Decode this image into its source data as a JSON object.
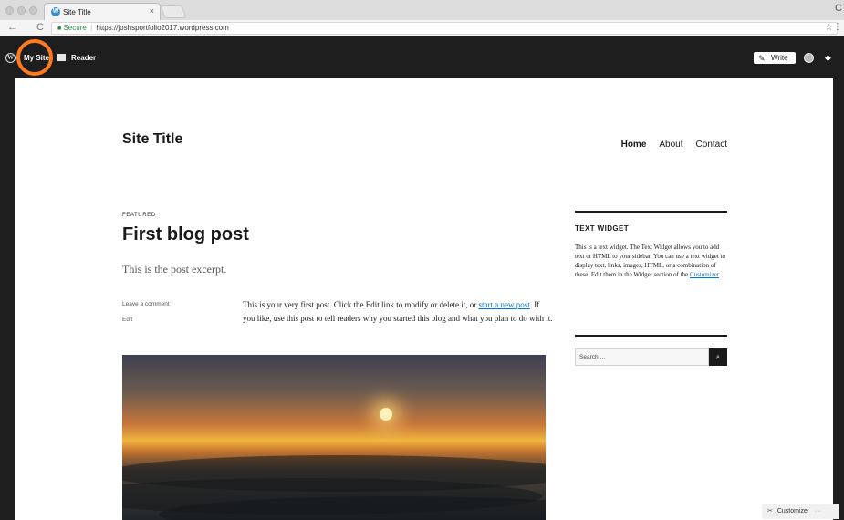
{
  "browser": {
    "tab_title": "Site Title",
    "tab_close": "×",
    "favicon": "W",
    "security_label": "Secure",
    "url": "https://joshsportfolio2017.wordpress.com",
    "back_icon": "←",
    "refresh_icon": "C",
    "star_icon": "☆",
    "menu_icon": "⋮",
    "corner_glyph": "C"
  },
  "adminbar": {
    "wp_logo": "W",
    "my_site": "My Site",
    "reader": "Reader",
    "write": "Write",
    "write_icon": "✎",
    "notif_icon": "◆"
  },
  "site": {
    "title": "Site Title",
    "nav": [
      "Home",
      "About",
      "Contact"
    ]
  },
  "post": {
    "label": "FEATURED",
    "title": "First blog post",
    "excerpt": "This is the post excerpt.",
    "meta_comment": "Leave a comment",
    "meta_edit": "Edit",
    "body_1": "This is your very first post. Click the Edit link to modify or delete it, or",
    "body_link": "start a new post",
    "body_2": ". If you like, use this post to tell readers why you started this blog and what you plan to do with it."
  },
  "sidebar": {
    "widget_title": "TEXT WIDGET",
    "widget_text": "This is a text widget. The Text Widget allows you to add text or HTML to your sidebar. You can use a text widget to display text, links, images, HTML, or a combination of these. Edit them in the Widget section of the",
    "widget_link": "Customizer",
    "widget_end": ".",
    "search_placeholder": "Search …",
    "search_icon": "🔍"
  },
  "customize": {
    "label": "Customize",
    "icon": "✂",
    "more": "···"
  },
  "colors": {
    "accent_ring": "#ff7a1c",
    "link": "#007acc",
    "secure_green": "#1e8e3e"
  }
}
